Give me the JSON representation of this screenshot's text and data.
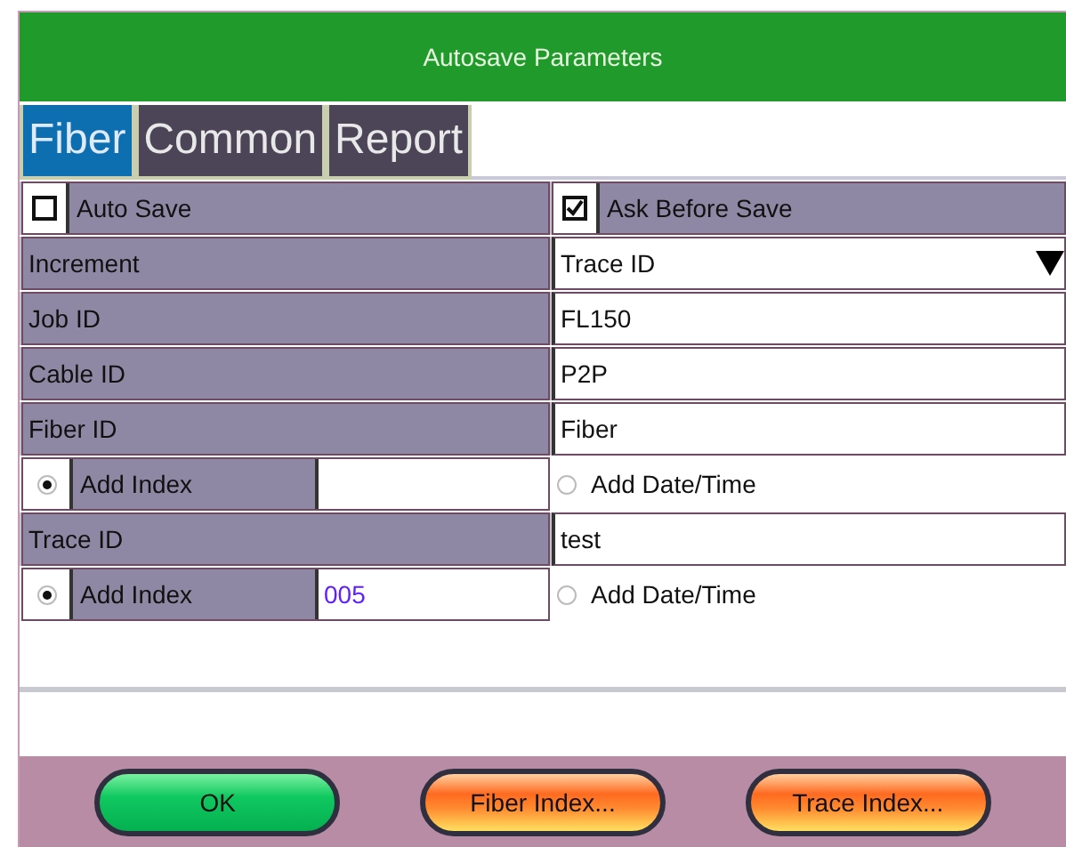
{
  "window": {
    "title": "Autosave Parameters"
  },
  "tabs": [
    {
      "label": "Fiber",
      "selected": true
    },
    {
      "label": "Common",
      "selected": false
    },
    {
      "label": "Report",
      "selected": false
    }
  ],
  "rows": [
    {
      "kind": "checks",
      "left": {
        "label": "Auto Save",
        "checked": false
      },
      "right": {
        "label": "Ask Before Save",
        "checked": true
      }
    },
    {
      "kind": "dropdown",
      "label": "Increment",
      "value": "Trace ID"
    },
    {
      "kind": "field",
      "label": "Job ID",
      "value": "FL150"
    },
    {
      "kind": "field",
      "label": "Cable ID",
      "value": "P2P"
    },
    {
      "kind": "field",
      "label": "Fiber ID",
      "value": "Fiber"
    },
    {
      "kind": "index",
      "index": {
        "label": "Add Index",
        "selected": true
      },
      "date": {
        "label": "Add Date/Time",
        "selected": false
      }
    },
    {
      "kind": "field",
      "label": "Trace ID",
      "value": "test"
    },
    {
      "kind": "index",
      "index": {
        "label": "Add Index",
        "selected": true,
        "value": "005"
      },
      "date": {
        "label": "Add Date/Time",
        "selected": false
      }
    }
  ],
  "buttons": [
    {
      "label": "OK",
      "kind": "confirm"
    },
    {
      "label": "Fiber Index...",
      "kind": "index"
    },
    {
      "label": "Trace Index...",
      "kind": "index"
    }
  ]
}
